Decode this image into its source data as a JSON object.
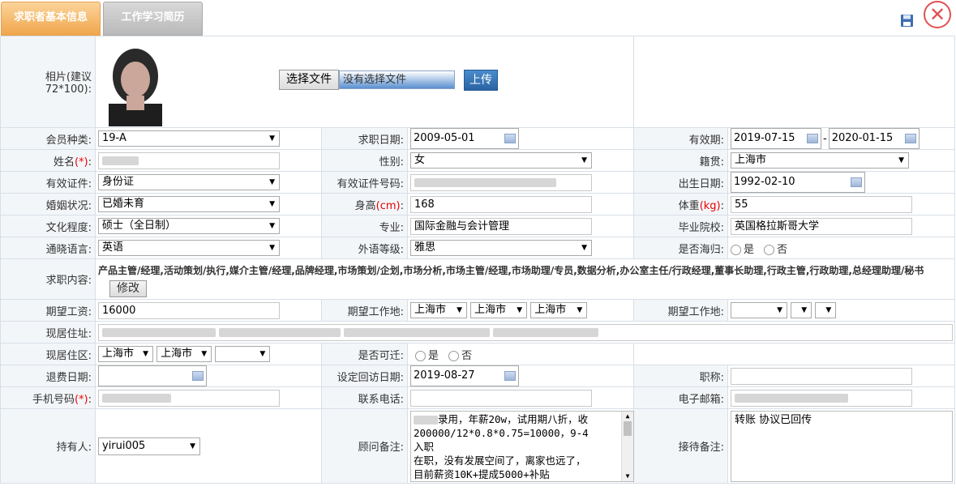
{
  "tabs": {
    "basic": "求职者基本信息",
    "history": "工作学习简历"
  },
  "photo": {
    "label": "相片(建议72*100):",
    "choose_btn": "选择文件",
    "no_file": "没有选择文件",
    "upload_btn": "上传"
  },
  "fields": {
    "member_type": {
      "label": "会员种类:",
      "value": "19-A"
    },
    "apply_date": {
      "label": "求职日期:",
      "value": "2009-05-01"
    },
    "validity": {
      "label": "有效期:",
      "from": "2019-07-15",
      "sep": "-",
      "to": "2020-01-15"
    },
    "name": {
      "label": "姓名",
      "req": "(*)",
      "colon": ":"
    },
    "gender": {
      "label": "性别:",
      "value": "女"
    },
    "native": {
      "label": "籍贯:",
      "value": "上海市"
    },
    "id_type": {
      "label": "有效证件:",
      "value": "身份证"
    },
    "id_no": {
      "label": "有效证件号码:"
    },
    "birth": {
      "label": "出生日期:",
      "value": "1992-02-10"
    },
    "marital": {
      "label": "婚姻状况:",
      "value": "已婚未育"
    },
    "height": {
      "label": "身高",
      "unit": "(cm)",
      "colon": ":",
      "value": "168"
    },
    "weight": {
      "label": "体重",
      "unit": "(kg)",
      "colon": ":",
      "value": "55"
    },
    "education": {
      "label": "文化程度:",
      "value": "硕士（全日制）"
    },
    "major": {
      "label": "专业:",
      "value": "国际金融与会计管理"
    },
    "school": {
      "label": "毕业院校:",
      "value": "英国格拉斯哥大学"
    },
    "language": {
      "label": "通晓语言:",
      "value": "英语"
    },
    "lang_level": {
      "label": "外语等级:",
      "value": "雅思"
    },
    "returnee": {
      "label": "是否海归:",
      "yes": "是",
      "no": "否"
    },
    "job_content": {
      "label": "求职内容:",
      "value": "产品主管/经理,活动策划/执行,媒介主管/经理,品牌经理,市场策划/企划,市场分析,市场主管/经理,市场助理/专员,数据分析,办公室主任/行政经理,董事长助理,行政主管,行政助理,总经理助理/秘书",
      "edit_btn": "修改"
    },
    "salary": {
      "label": "期望工资:",
      "value": "16000"
    },
    "work_place1": {
      "label": "期望工作地:",
      "v1": "上海市",
      "v2": "上海市",
      "v3": "上海市"
    },
    "work_place2": {
      "label": "期望工作地:"
    },
    "address": {
      "label": "现居住址:"
    },
    "district": {
      "label": "现居住区:",
      "v1": "上海市",
      "v2": "上海市"
    },
    "relocate": {
      "label": "是否可迁:",
      "yes": "是",
      "no": "否"
    },
    "refund_date": {
      "label": "退费日期:"
    },
    "revisit_date": {
      "label": "设定回访日期:",
      "value": "2019-08-27"
    },
    "title": {
      "label": "职称:"
    },
    "mobile": {
      "label": "手机号码",
      "req": "(*)",
      "colon": ":"
    },
    "phone": {
      "label": "联系电话:"
    },
    "email": {
      "label": "电子邮箱:"
    },
    "holder": {
      "label": "持有人:",
      "value": "yirui005"
    },
    "advisor_note": {
      "label": "顾问备注:",
      "lines": [
        "录用，年薪20w，试用期八折，收",
        "200000/12*0.8*0.75=10000，9-4",
        "入职",
        "在职，没有发展空间了，离家也远了，",
        "目前薪资10K+提成5000+补贴"
      ]
    },
    "reception_note": {
      "label": "接待备注:",
      "value": "转账 协议已回传"
    }
  }
}
